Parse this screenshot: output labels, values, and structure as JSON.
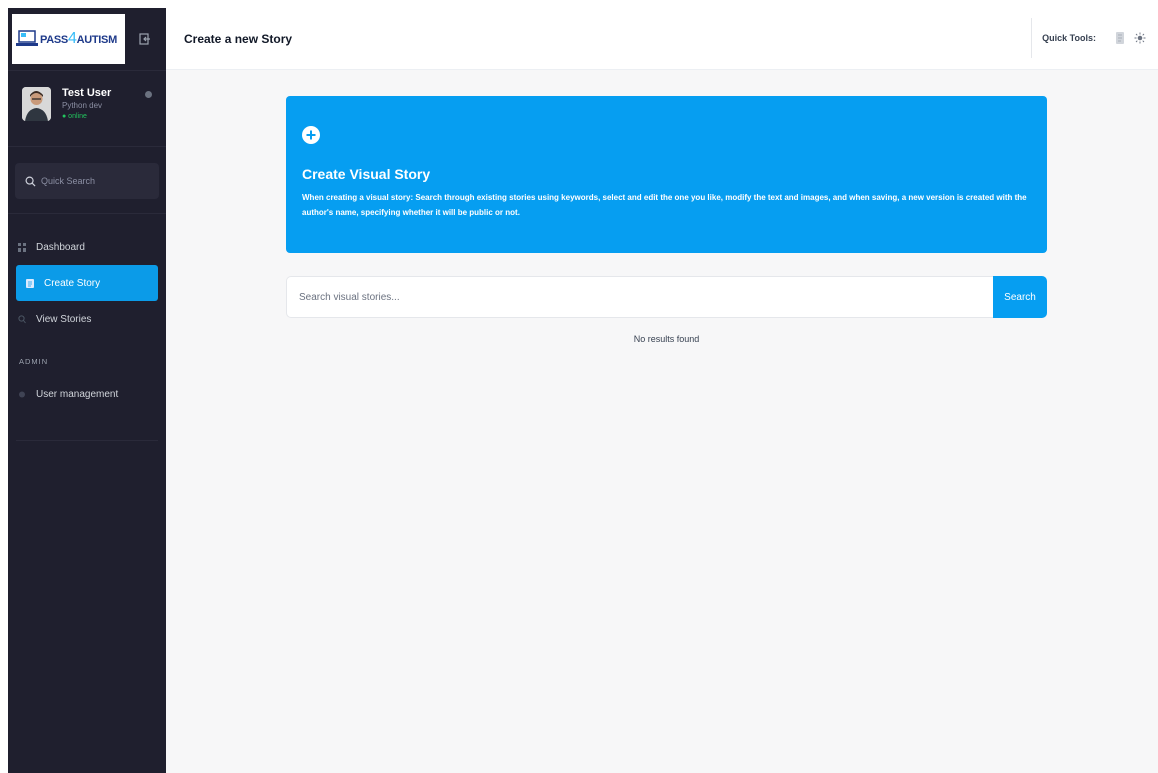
{
  "brand": {
    "logo_prefix": "PASS",
    "logo_digit": "4",
    "logo_suffix": "AUTISM"
  },
  "user": {
    "name": "Test User",
    "role": "Python dev",
    "status": "● online"
  },
  "sidebar": {
    "quick_search_placeholder": "Quick Search",
    "items": [
      {
        "label": "Dashboard",
        "icon": "grid-icon"
      },
      {
        "label": "Create Story",
        "icon": "document-icon",
        "active": true
      },
      {
        "label": "View Stories",
        "icon": "search-icon"
      }
    ],
    "admin_label": "ADMIN",
    "admin_items": [
      {
        "label": "User management",
        "icon": "users-icon"
      }
    ]
  },
  "header": {
    "title": "Create a new Story",
    "quick_tools_label": "Quick Tools:",
    "quick_tools_icons": [
      "document-icon",
      "sun-icon"
    ]
  },
  "hero": {
    "title": "Create Visual Story",
    "description": "When creating a visual story: Search through existing stories using keywords, select and edit the one you like, modify the text and images, and when saving, a new version is created with the author's name, specifying whether it will be public or not."
  },
  "search": {
    "placeholder": "Search visual stories...",
    "button_label": "Search"
  },
  "results": {
    "empty_text": "No results found"
  },
  "colors": {
    "accent": "#069ef1",
    "sidebar_bg": "#1f1f2e",
    "online": "#22c55e"
  }
}
